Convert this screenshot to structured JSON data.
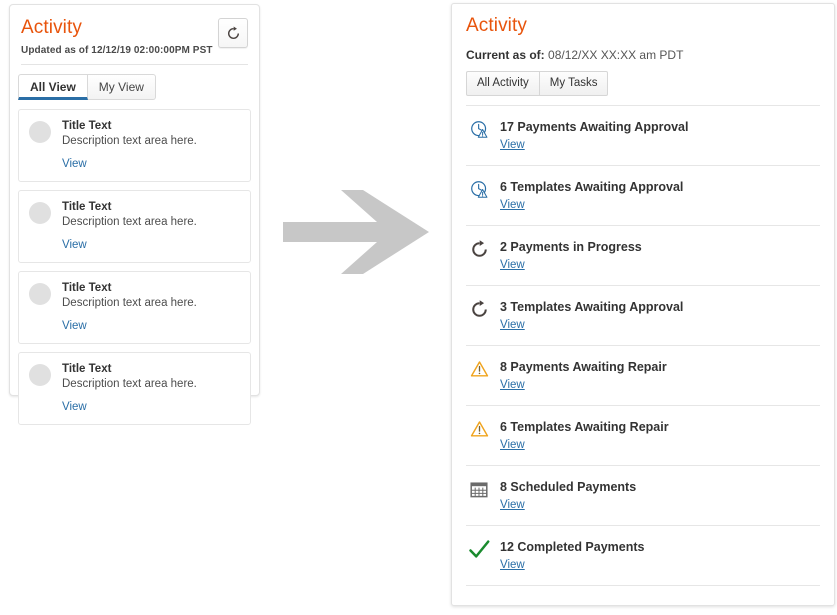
{
  "before": {
    "title": "Activity",
    "updated_label": "Updated as of 12/12/19 02:00:00PM PST",
    "refresh_icon": "refresh-icon",
    "tabs": [
      {
        "label": "All View",
        "active": true
      },
      {
        "label": "My View",
        "active": false
      }
    ],
    "cards": [
      {
        "icon": "avatar-circle-icon",
        "title": "Title Text",
        "description": "Description text area here.",
        "link": "View"
      },
      {
        "icon": "avatar-circle-icon",
        "title": "Title Text",
        "description": "Description text area here.",
        "link": "View"
      },
      {
        "icon": "avatar-circle-icon",
        "title": "Title Text",
        "description": "Description text area here.",
        "link": "View"
      },
      {
        "icon": "avatar-circle-icon",
        "title": "Title Text",
        "description": "Description text area here.",
        "link": "View"
      }
    ]
  },
  "arrow": {
    "icon": "right-arrow-icon",
    "color": "#c7c7c7"
  },
  "after": {
    "title": "Activity",
    "current_label": "Current as of:",
    "current_value": "08/12/XX XX:XX am PDT",
    "tabs": [
      {
        "label": "All Activity",
        "active": true
      },
      {
        "label": "My Tasks",
        "active": false
      }
    ],
    "rows": [
      {
        "icon": "clock-warning-icon",
        "icon_color": "#2a6ea6",
        "title": "17 Payments Awaiting Approval",
        "link": "View"
      },
      {
        "icon": "clock-warning-icon",
        "icon_color": "#2a6ea6",
        "title": "6 Templates Awaiting Approval",
        "link": "View"
      },
      {
        "icon": "refresh-icon",
        "icon_color": "#4a4340",
        "title": "2 Payments in Progress",
        "link": "View"
      },
      {
        "icon": "refresh-icon",
        "icon_color": "#4a4340",
        "title": "3 Templates Awaiting Approval",
        "link": "View"
      },
      {
        "icon": "warning-triangle-icon",
        "icon_color": "#f0a41e",
        "title": "8 Payments Awaiting Repair",
        "link": "View"
      },
      {
        "icon": "warning-triangle-icon",
        "icon_color": "#f0a41e",
        "title": "6 Templates Awaiting Repair",
        "link": "View"
      },
      {
        "icon": "calendar-icon",
        "icon_color": "#6b6b6b",
        "title": "8 Scheduled Payments",
        "link": "View"
      },
      {
        "icon": "check-mark-icon",
        "icon_color": "#1a8b2e",
        "title": "12 Completed Payments",
        "link": "View"
      }
    ]
  },
  "colors": {
    "brand_orange": "#e8540c",
    "link_blue": "#2a6ea6",
    "warning_amber": "#f0a41e",
    "success_green": "#1a8b2e",
    "arrow_gray": "#c7c7c7"
  }
}
